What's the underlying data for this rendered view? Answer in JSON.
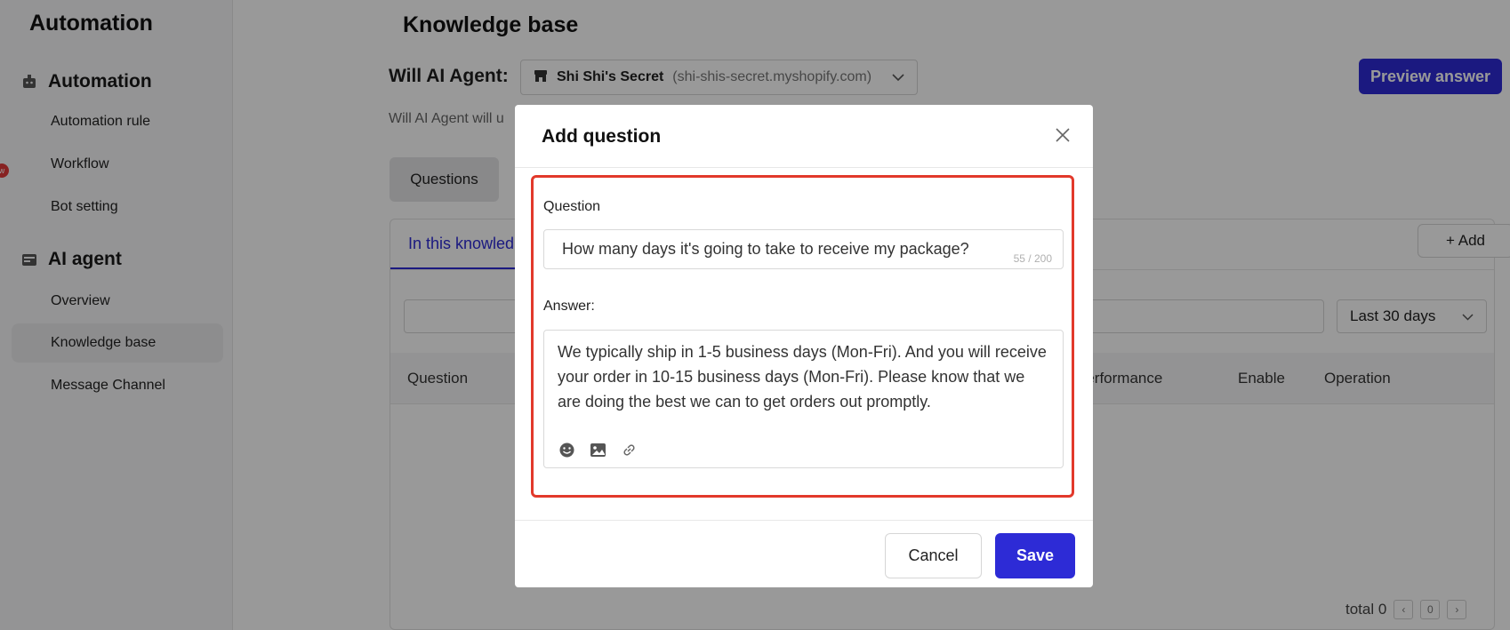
{
  "sidebar": {
    "app_title": "Automation",
    "sections": [
      {
        "label": "Automation",
        "icon": "bot-icon",
        "items": [
          "Automation rule",
          "Workflow",
          "Bot setting"
        ]
      },
      {
        "label": "AI agent",
        "icon": "ai-agent-icon",
        "items": [
          "Overview",
          "Knowledge base",
          "Message Channel"
        ]
      }
    ],
    "active_item": "Knowledge base"
  },
  "header": {
    "page_title": "Knowledge base",
    "agent_label": "Will AI Agent:",
    "store_name": "Shi Shi's Secret",
    "store_url": "(shi-shis-secret.myshopify.com)",
    "preview_label": "Preview answer",
    "description": "Will AI Agent will u"
  },
  "tabs": {
    "questions": "Questions"
  },
  "panel": {
    "tab_label": "In this knowled",
    "add_label": "+ Add",
    "date_filter": "Last 30 days",
    "columns": [
      "Question",
      "Performance",
      "Enable",
      "Operation"
    ],
    "total_label": "total 0",
    "page": "0"
  },
  "modal": {
    "title": "Add question",
    "question_label": "Question",
    "question_value": "How many days it's going to take to receive my package?",
    "question_count": "55 / 200",
    "answer_label": "Answer:",
    "answer_value": "We typically ship in 1-5 business days (Mon-Fri).  And you will receive your order in 10-15 business days (Mon-Fri). Please know that we are doing the best we can to get orders out promptly.",
    "cancel_label": "Cancel",
    "save_label": "Save"
  },
  "colors": {
    "accent": "#2d2bd6",
    "highlight": "#e2392b",
    "badge": "#e23a3a"
  }
}
